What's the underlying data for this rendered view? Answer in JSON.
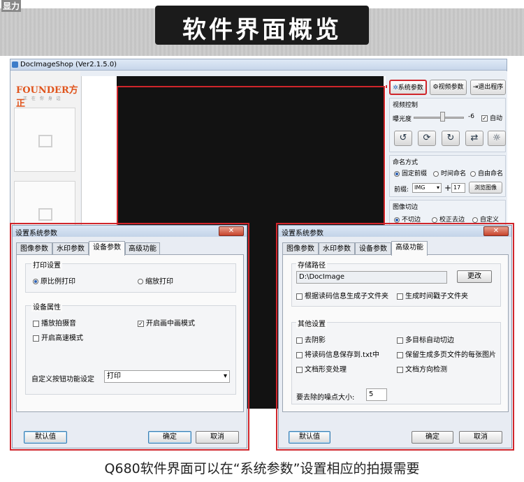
{
  "banner": {
    "title": "软件界面概览",
    "corner": "显力"
  },
  "app": {
    "title": "DocImageShop (Ver2.1.5.0)",
    "logo": "FOUNDER方正",
    "logo_sub": "正 在 你 身 边",
    "toolbar": {
      "system_params": "系统参数",
      "video_params": "视频参数",
      "exit": "退出程序"
    },
    "video_control": {
      "label": "视频控制",
      "exposure_label": "曝光度",
      "exposure_value": "-6",
      "auto_label": "自动"
    },
    "naming": {
      "label": "命名方式",
      "options": [
        "固定前缀",
        "时间命名",
        "自由命名"
      ],
      "prefix_label": "前缀:",
      "prefix_value": "IMG",
      "counter": "17",
      "browse": "浏览图像"
    },
    "cropping": {
      "label": "图像切边",
      "options": [
        "不切边",
        "校正去边",
        "自定义"
      ]
    }
  },
  "left_dialog": {
    "title": "设置系统参数",
    "close": "✕",
    "tabs": [
      "图像参数",
      "水印参数",
      "设备参数",
      "高级功能"
    ],
    "print": {
      "label": "打印设置",
      "opt1": "原比例打印",
      "opt2": "缩放打印"
    },
    "device": {
      "label": "设备属性",
      "opt1": "播放拍摄音",
      "opt2": "开启画中画模式",
      "opt3": "开启高速模式"
    },
    "custom_btn_label": "自定义按钮功能设定",
    "custom_btn_value": "打印",
    "default": "默认值",
    "ok": "确定",
    "cancel": "取消"
  },
  "right_dialog": {
    "title": "设置系统参数",
    "close": "✕",
    "tabs": [
      "图像参数",
      "水印参数",
      "设备参数",
      "高级功能"
    ],
    "storage": {
      "label": "存储路径",
      "path": "D:\\DocImage",
      "change": "更改",
      "opt1": "根据读码信息生成子文件夹",
      "opt2": "生成时间戳子文件夹"
    },
    "other": {
      "label": "其他设置",
      "items": [
        "去阴影",
        "多目标自动切边",
        "将读码信息保存到.txt中",
        "保留生成多页文件的每张图片",
        "文档形变处理",
        "文档方向检测"
      ],
      "noise_label": "要去除的噪点大小:",
      "noise_value": "5"
    },
    "default": "默认值",
    "ok": "确定",
    "cancel": "取消"
  },
  "caption": "Q680软件界面可以在“系统参数”设置相应的拍摄需要"
}
